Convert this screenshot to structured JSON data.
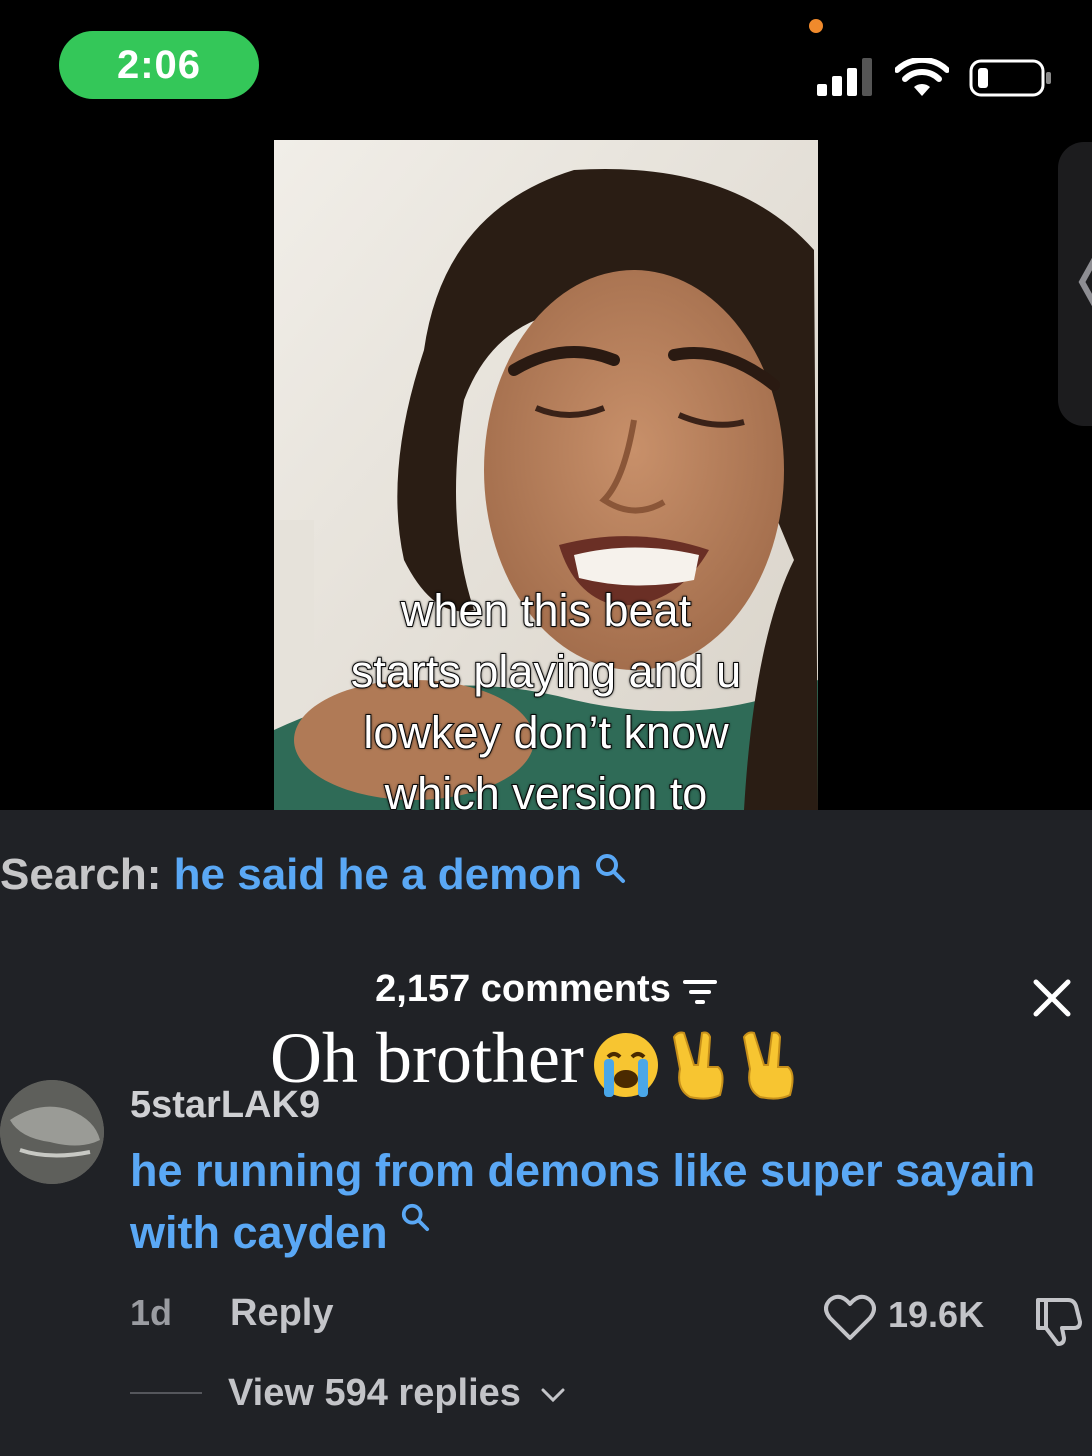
{
  "status_bar": {
    "time": "2:06"
  },
  "video": {
    "caption": "when this beat\nstarts playing and u\nlowkey don’t know\nwhich version to"
  },
  "search": {
    "label": "Search:",
    "term": "he said he a demon"
  },
  "comments": {
    "count_label": "2,157 comments",
    "overlay_text": "Oh brother",
    "item": {
      "username": "5starLAK9",
      "text": "he running from demons like super sayain with cayden",
      "age": "1d",
      "reply_label": "Reply",
      "likes": "19.6K",
      "view_replies": "View 594 replies"
    }
  },
  "colors": {
    "link_blue": "#5aa8f5",
    "status_green": "#34c759",
    "panel_bg": "#202226"
  }
}
